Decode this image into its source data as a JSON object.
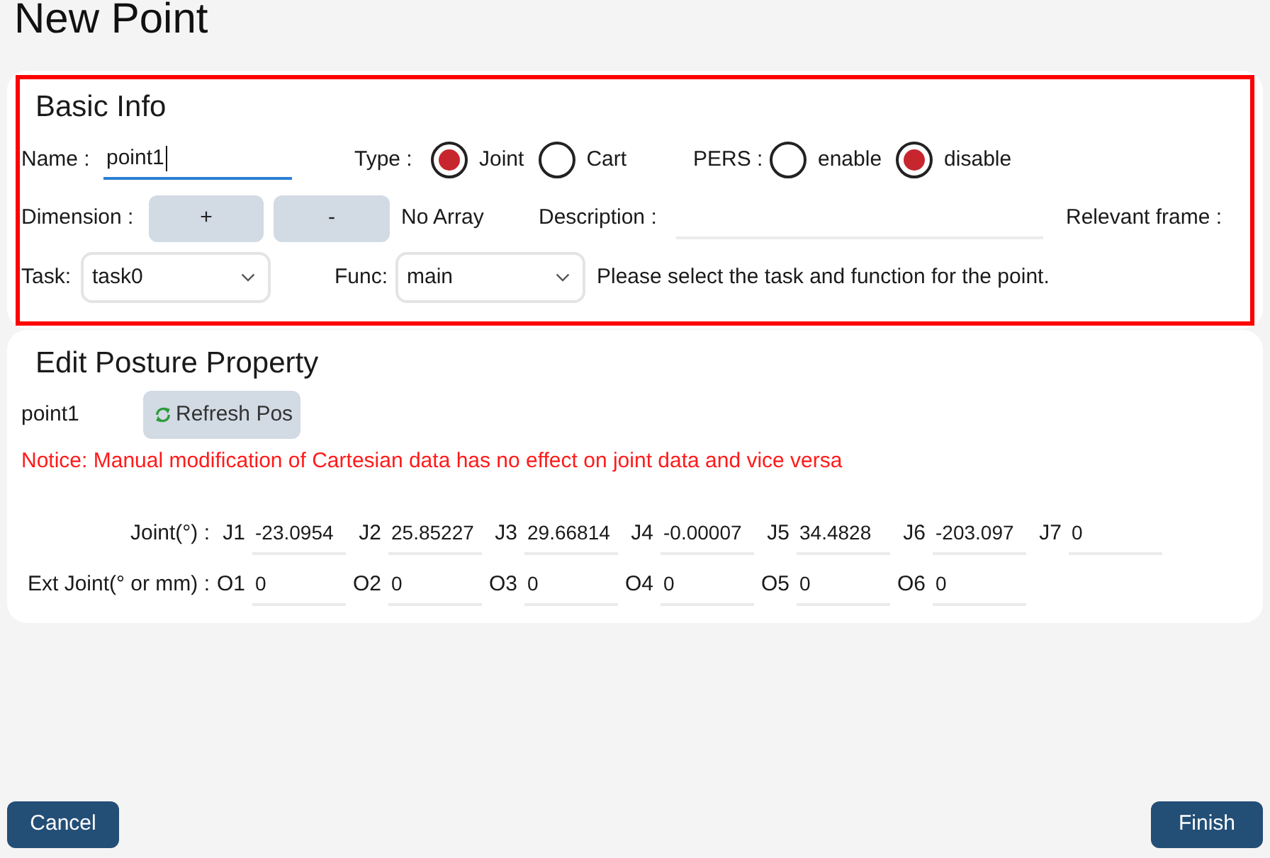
{
  "title": "New Point",
  "basic_info": {
    "heading": "Basic Info",
    "name": {
      "label": "Name :",
      "value": "point1",
      "focused": true
    },
    "type": {
      "label": "Type :",
      "options": [
        {
          "label": "Joint",
          "selected": true
        },
        {
          "label": "Cart",
          "selected": false
        }
      ]
    },
    "pers": {
      "label": "PERS :",
      "options": [
        {
          "label": "enable",
          "selected": false
        },
        {
          "label": "disable",
          "selected": true
        }
      ]
    },
    "dimension": {
      "label": "Dimension :",
      "buttons": [
        "+",
        "-"
      ],
      "status": "No Array"
    },
    "description": {
      "label": "Description :"
    },
    "relevant_frame": {
      "label": "Relevant frame :"
    },
    "task": {
      "label": "Task:",
      "value": "task0"
    },
    "func": {
      "label": "Func:",
      "value": "main"
    },
    "hint": "Please select the task and function for the point."
  },
  "posture": {
    "heading": "Edit Posture Property",
    "point_name": "point1",
    "refresh_button": "Refresh Pos",
    "notice": "Notice: Manual modification of Cartesian data has no effect on joint data and vice versa",
    "joint": {
      "label": "Joint(°) :",
      "fields": [
        {
          "label": "J1",
          "value": "-23.0954"
        },
        {
          "label": "J2",
          "value": "25.85227"
        },
        {
          "label": "J3",
          "value": "29.66814"
        },
        {
          "label": "J4",
          "value": "-0.00007"
        },
        {
          "label": "J5",
          "value": "34.4828"
        },
        {
          "label": "J6",
          "value": "-203.097"
        },
        {
          "label": "J7",
          "value": "0"
        }
      ]
    },
    "ext_joint": {
      "label": "Ext Joint(° or mm) :",
      "fields": [
        {
          "label": "O1",
          "value": "0"
        },
        {
          "label": "O2",
          "value": "0"
        },
        {
          "label": "O3",
          "value": "0"
        },
        {
          "label": "O4",
          "value": "0"
        },
        {
          "label": "O5",
          "value": "0"
        },
        {
          "label": "O6",
          "value": "0"
        }
      ]
    }
  },
  "footer": {
    "cancel": "Cancel",
    "finish": "Finish"
  }
}
